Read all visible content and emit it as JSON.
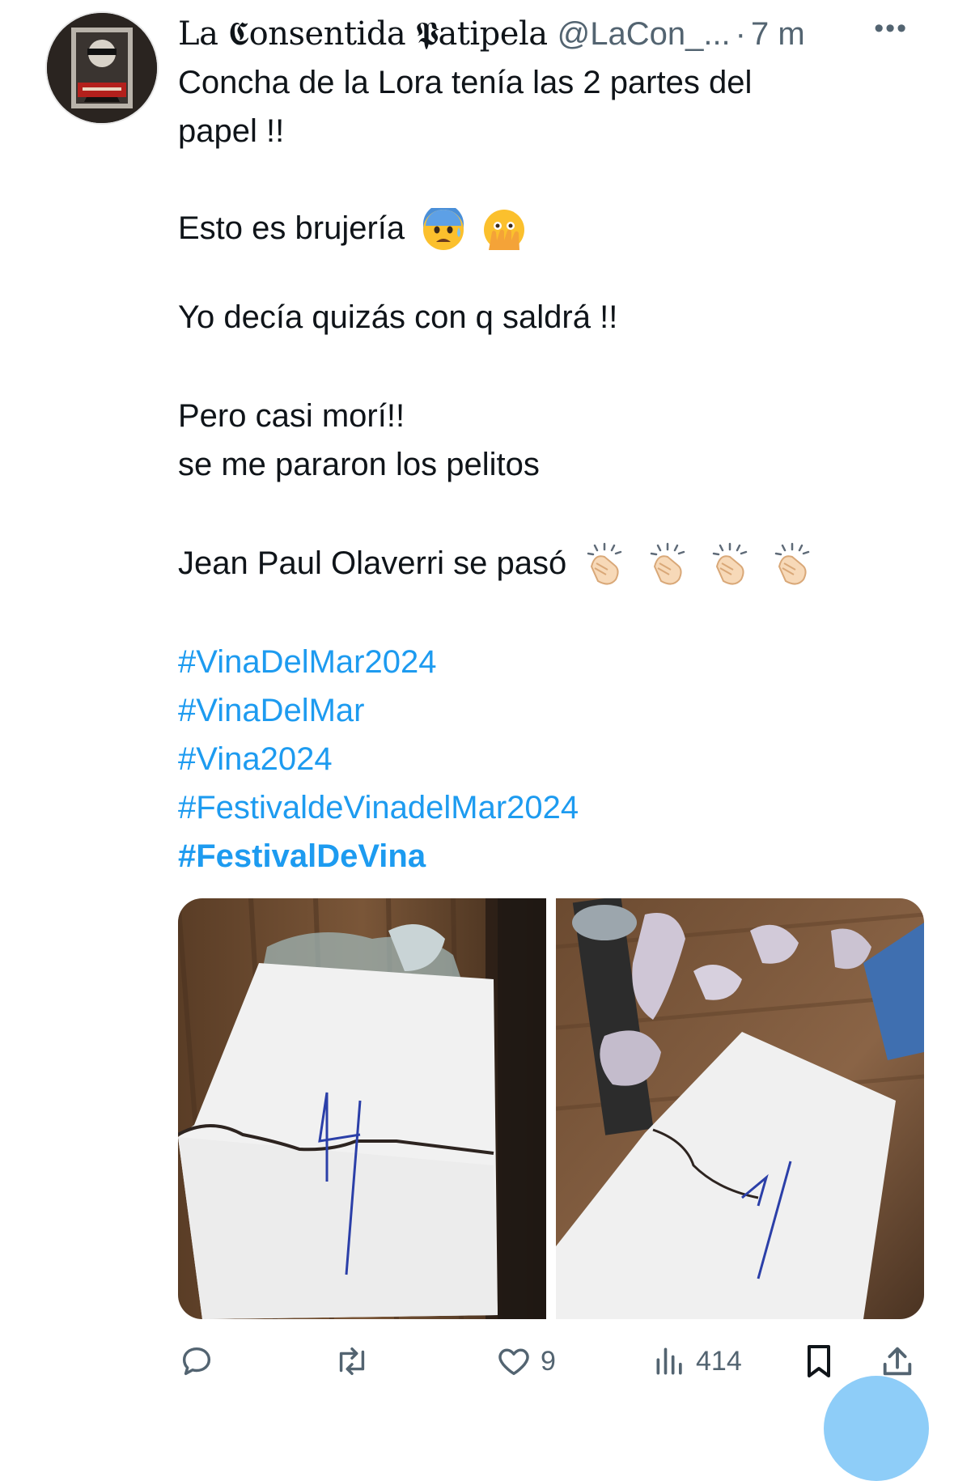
{
  "tweet": {
    "author": {
      "display_name": "La 𝕮onsentida 𝕻atipela",
      "handle": "@LaCon_...",
      "separator": "·",
      "time": "7 m"
    },
    "more_label": "•••",
    "lines": {
      "l1": "Concha de la Lora  tenía las 2 partes del",
      "l2": "papel  !!",
      "l3": "Esto es brujería",
      "l4": "Yo decía quizás con q saldrá !!",
      "l5": "Pero casi morí!!",
      "l6": "se me pararon los pelitos",
      "l7": "Jean Paul Olaverri se pasó"
    },
    "emojis": {
      "l3": [
        "anxious-face-with-sweat",
        "face-with-open-eyes-and-hand-over-mouth"
      ],
      "l7": [
        "clapping-hands",
        "clapping-hands",
        "clapping-hands",
        "clapping-hands"
      ]
    },
    "hashtags": [
      "#VinaDelMar2024",
      "#VinaDelMar",
      "#Vina2024",
      "#FestivaldeVinadelMar2024",
      "#FestivalDeVina"
    ],
    "actions": {
      "replies": "",
      "reposts": "",
      "likes": "9",
      "views": "414"
    },
    "colors": {
      "link": "#1d9bf0",
      "secondary_text": "#536471",
      "text": "#0f1419"
    }
  }
}
